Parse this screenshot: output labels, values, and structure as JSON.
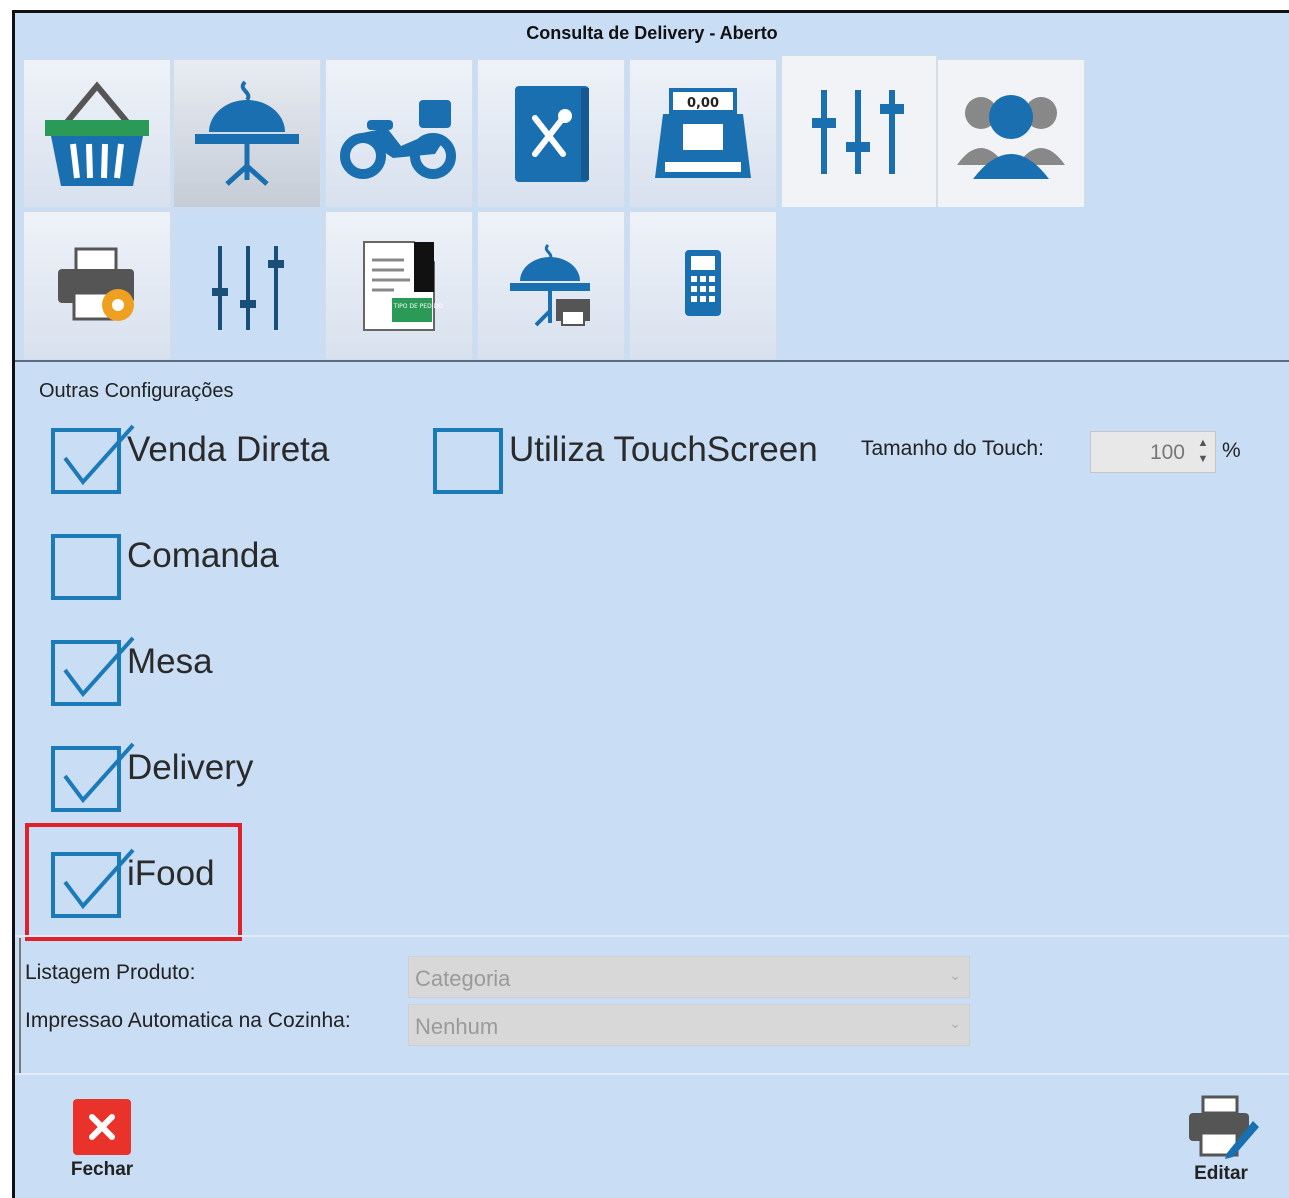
{
  "window": {
    "title": "Consulta de Delivery - Aberto"
  },
  "tabs_row1": [
    {
      "name": "basket-icon"
    },
    {
      "name": "cloche-table-icon"
    },
    {
      "name": "motorcycle-delivery-icon"
    },
    {
      "name": "menu-book-icon"
    },
    {
      "name": "cash-register-icon"
    },
    {
      "name": "sliders-icon"
    },
    {
      "name": "users-group-icon"
    }
  ],
  "cash_register_display": "0,00",
  "document_tag": "IMP TIPO DE PEDIDO",
  "tabs_row2": [
    {
      "name": "printer-settings-icon"
    },
    {
      "name": "sliders-thin-icon"
    },
    {
      "name": "document-order-type-icon"
    },
    {
      "name": "cloche-printer-icon"
    },
    {
      "name": "calculator-phone-icon"
    }
  ],
  "group": {
    "label": "Outras Configurações"
  },
  "options": {
    "venda_direta": {
      "label": "Venda Direta",
      "checked": true
    },
    "utiliza_touch": {
      "label": "Utiliza TouchScreen",
      "checked": false
    },
    "comanda": {
      "label": "Comanda",
      "checked": false
    },
    "mesa": {
      "label": "Mesa",
      "checked": true
    },
    "delivery": {
      "label": "Delivery",
      "checked": true
    },
    "ifood": {
      "label": "iFood",
      "checked": true
    }
  },
  "touch": {
    "label": "Tamanho do Touch:",
    "value": "100",
    "unit": "%"
  },
  "listagem": {
    "label": "Listagem Produto:",
    "value": "Categoria"
  },
  "impressao": {
    "label": "Impressao Automatica na Cozinha:",
    "value": "Nenhum"
  },
  "footer": {
    "close_label": "Fechar",
    "edit_label": "Editar"
  },
  "colors": {
    "accent": "#1b7ab8",
    "highlight": "#e0202a",
    "background": "#c9ddf5"
  }
}
